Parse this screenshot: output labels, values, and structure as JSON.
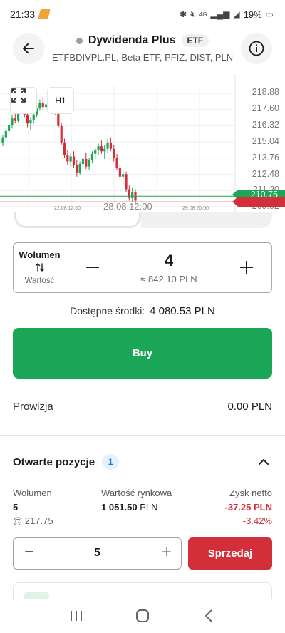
{
  "status_bar": {
    "time": "21:33",
    "battery": "19%",
    "net": "4G",
    "icons": [
      "notification-app-icon",
      "bluetooth-icon",
      "mute-icon",
      "signal-icon",
      "wifi-icon",
      "battery-icon"
    ]
  },
  "header": {
    "title": "Dywidenda Plus",
    "badge": "ETF",
    "subtitle": "ETFBDIVPL.PL, Beta ETF, PFIZ, DIST, PLN",
    "back_icon": "arrow-left-icon",
    "info_icon": "info-icon"
  },
  "chart": {
    "timeframe": "H1",
    "expand_icon": "expand-icon",
    "y_labels": [
      "218.88",
      "217.60",
      "216.32",
      "215.04",
      "213.76",
      "212.48",
      "211.20",
      "209.92"
    ],
    "x_labels": [
      "22.08 12:00",
      "28.08 12:00",
      "29.08 20:00"
    ],
    "bid_price": "210.75",
    "ask_price": "210.30",
    "colors": {
      "up": "#1ea555",
      "down": "#d32f3a"
    }
  },
  "chart_data": {
    "type": "candlestick",
    "x_labels": [
      "22.08 12:00",
      "28.08 12:00",
      "29.08 20:00"
    ],
    "ylim": [
      209.92,
      219.5
    ],
    "y_ticks": [
      218.88,
      217.6,
      216.32,
      215.04,
      213.76,
      212.48,
      211.2,
      209.92
    ],
    "price_lines": {
      "green": 210.75,
      "red": 210.3
    },
    "candles": [
      [
        215.0,
        215.6,
        214.7,
        215.4
      ],
      [
        215.4,
        216.1,
        215.2,
        215.9
      ],
      [
        215.9,
        216.6,
        215.7,
        216.4
      ],
      [
        216.4,
        217.2,
        216.1,
        216.9
      ],
      [
        216.9,
        217.5,
        216.5,
        216.7
      ],
      [
        216.7,
        217.8,
        216.6,
        217.6
      ],
      [
        217.6,
        218.3,
        217.3,
        218.0
      ],
      [
        218.0,
        218.4,
        217.0,
        217.2
      ],
      [
        217.2,
        217.6,
        216.2,
        216.5
      ],
      [
        216.5,
        217.0,
        216.0,
        216.8
      ],
      [
        216.8,
        217.4,
        216.5,
        217.2
      ],
      [
        217.2,
        217.9,
        217.0,
        217.7
      ],
      [
        217.7,
        218.4,
        217.5,
        218.1
      ],
      [
        218.1,
        218.6,
        217.6,
        217.8
      ],
      [
        217.8,
        218.2,
        217.3,
        218.0
      ],
      [
        218.0,
        218.7,
        217.8,
        218.4
      ],
      [
        218.4,
        218.9,
        218.0,
        218.2
      ],
      [
        218.2,
        218.5,
        217.2,
        217.4
      ],
      [
        217.4,
        217.8,
        216.1,
        216.3
      ],
      [
        216.3,
        216.5,
        214.8,
        215.0
      ],
      [
        215.0,
        215.3,
        213.8,
        214.0
      ],
      [
        214.0,
        214.4,
        213.2,
        213.5
      ],
      [
        213.5,
        214.2,
        213.1,
        213.9
      ],
      [
        213.9,
        214.3,
        213.0,
        213.2
      ],
      [
        213.2,
        213.6,
        212.3,
        212.6
      ],
      [
        212.6,
        213.5,
        212.4,
        213.3
      ],
      [
        213.3,
        214.0,
        212.9,
        213.7
      ],
      [
        213.7,
        214.2,
        212.9,
        213.1
      ],
      [
        213.1,
        213.8,
        212.8,
        213.6
      ],
      [
        213.6,
        214.3,
        213.4,
        214.1
      ],
      [
        214.1,
        214.6,
        213.7,
        214.4
      ],
      [
        214.4,
        214.9,
        214.0,
        214.7
      ],
      [
        214.7,
        215.2,
        214.1,
        214.3
      ],
      [
        214.3,
        214.8,
        213.7,
        214.5
      ],
      [
        214.5,
        215.3,
        214.2,
        215.0
      ],
      [
        215.0,
        215.4,
        214.3,
        214.5
      ],
      [
        214.5,
        214.8,
        213.5,
        213.8
      ],
      [
        213.8,
        214.1,
        212.8,
        213.0
      ],
      [
        213.0,
        213.3,
        212.0,
        212.3
      ],
      [
        212.3,
        212.9,
        211.6,
        212.5
      ],
      [
        212.5,
        212.7,
        211.1,
        211.3
      ],
      [
        211.3,
        211.6,
        210.4,
        210.6
      ],
      [
        210.6,
        211.4,
        210.3,
        211.1
      ],
      [
        211.1,
        211.3,
        210.2,
        210.4
      ]
    ]
  },
  "order": {
    "mode_label": "Wolumen",
    "mode_alt_label": "Wartość",
    "swap_icon": "swap-vertical-icon",
    "volume": "4",
    "approx_value": "≈ 842.10 PLN",
    "available_label": "Dostępne środki:",
    "available_value": "4 080.53 PLN",
    "buy_label": "Buy",
    "fee_label": "Prowizja",
    "fee_value": "0.00 PLN"
  },
  "positions": {
    "title": "Otwarte pozycje",
    "count": "1",
    "columns": {
      "volume_header": "Wolumen",
      "volume_value": "5",
      "volume_sub": "@ 217.75",
      "market_header": "Wartość rynkowa",
      "market_value": "1 051.50",
      "market_unit": "PLN",
      "profit_header": "Zysk netto",
      "profit_value": "-37.25 PLN",
      "profit_pct": "-3.42%"
    },
    "close_qty": "5",
    "sell_label": "Sprzedaj"
  }
}
